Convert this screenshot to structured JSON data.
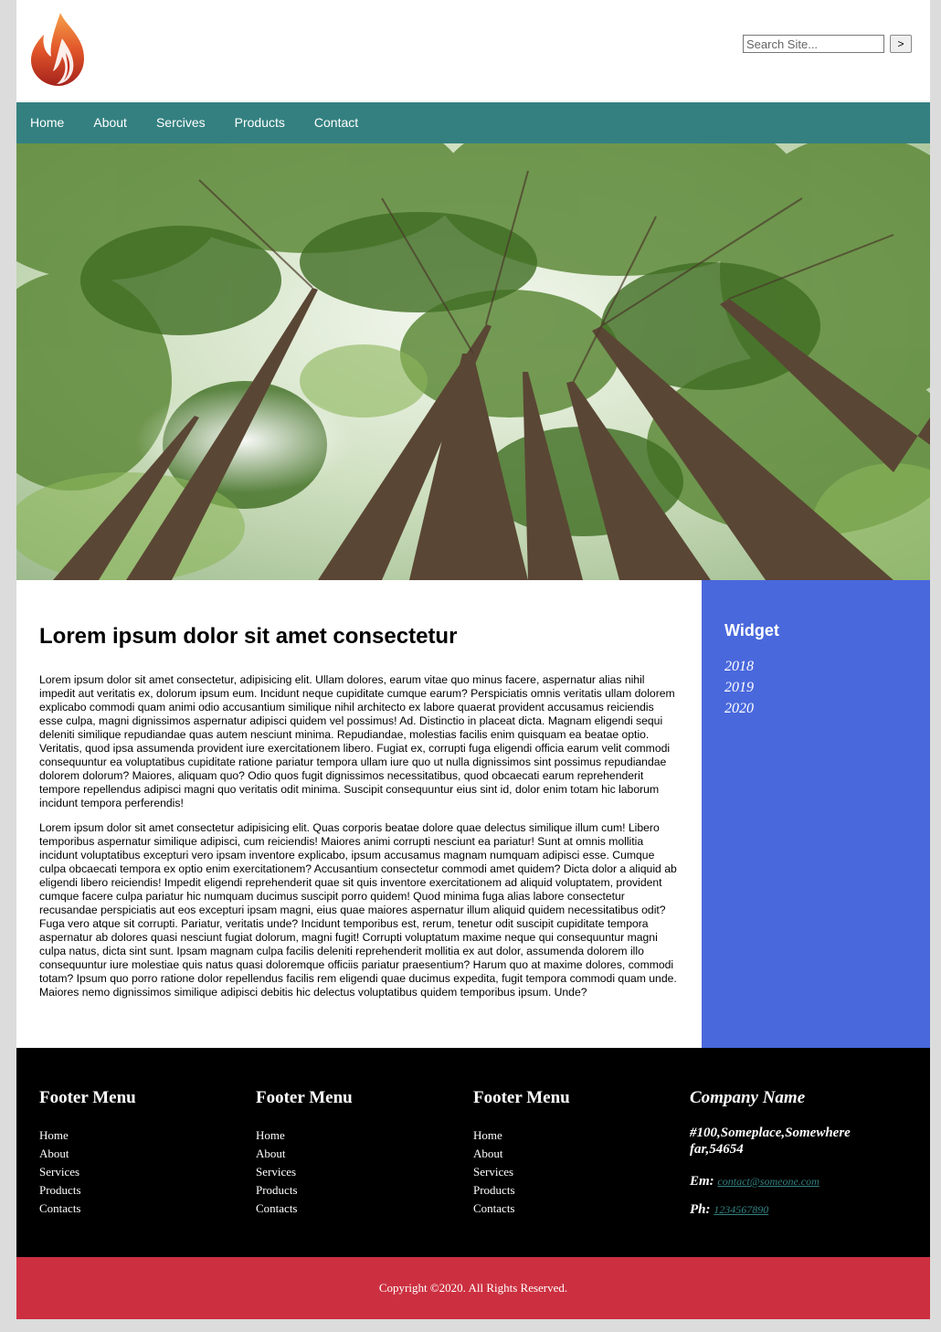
{
  "header": {
    "search_placeholder": "Search Site...",
    "search_button": ">"
  },
  "nav": {
    "items": [
      "Home",
      "About",
      "Sercives",
      "Products",
      "Contact"
    ]
  },
  "main": {
    "title": "Lorem ipsum dolor sit amet consectetur",
    "paragraph1": "Lorem ipsum dolor sit amet consectetur, adipisicing elit. Ullam dolores, earum vitae quo minus facere, aspernatur alias nihil impedit aut veritatis ex, dolorum ipsum eum. Incidunt neque cupiditate cumque earum? Perspiciatis omnis veritatis ullam dolorem explicabo commodi quam animi odio accusantium similique nihil architecto ex labore quaerat provident accusamus reiciendis esse culpa, magni dignissimos aspernatur adipisci quidem vel possimus! Ad. Distinctio in placeat dicta. Magnam eligendi sequi deleniti similique repudiandae quas autem nesciunt minima. Repudiandae, molestias facilis enim quisquam ea beatae optio. Veritatis, quod ipsa assumenda provident iure exercitationem libero. Fugiat ex, corrupti fuga eligendi officia earum velit commodi consequuntur ea voluptatibus cupiditate ratione pariatur tempora ullam iure quo ut nulla dignissimos sint possimus repudiandae dolorem dolorum? Maiores, aliquam quo? Odio quos fugit dignissimos necessitatibus, quod obcaecati earum reprehenderit tempore repellendus adipisci magni quo veritatis odit minima. Suscipit consequuntur eius sint id, dolor enim totam hic laborum incidunt tempora perferendis!",
    "paragraph2": "Lorem ipsum dolor sit amet consectetur adipisicing elit. Quas corporis beatae dolore quae delectus similique illum cum! Libero temporibus aspernatur similique adipisci, cum reiciendis! Maiores animi corrupti nesciunt ea pariatur! Sunt at omnis mollitia incidunt voluptatibus excepturi vero ipsam inventore explicabo, ipsum accusamus magnam numquam adipisci esse. Cumque culpa obcaecati tempora ex optio enim exercitationem? Accusantium consectetur commodi amet quidem? Dicta dolor a aliquid ab eligendi libero reiciendis! Impedit eligendi reprehenderit quae sit quis inventore exercitationem ad aliquid voluptatem, provident cumque facere culpa pariatur hic numquam ducimus suscipit porro quidem! Quod minima fuga alias labore consectetur recusandae perspiciatis aut eos excepturi ipsam magni, eius quae maiores aspernatur illum aliquid quidem necessitatibus odit? Fuga vero atque sit corrupti. Pariatur, veritatis unde? Incidunt temporibus est, rerum, tenetur odit suscipit cupiditate tempora aspernatur ab dolores quasi nesciunt fugiat dolorum, magni fugit! Corrupti voluptatum maxime neque qui consequuntur magni culpa natus, dicta sint sunt. Ipsam magnam culpa facilis deleniti reprehenderit mollitia ex aut dolor, assumenda dolorem illo consequuntur iure molestiae quis natus quasi doloremque officiis pariatur praesentium? Harum quo at maxime dolores, commodi totam? Ipsum quo porro ratione dolor repellendus facilis rem eligendi quae ducimus expedita, fugit tempora commodi quam unde. Maiores nemo dignissimos similique adipisci debitis hic delectus voluptatibus quidem temporibus ipsum. Unde?"
  },
  "sidebar": {
    "title": "Widget",
    "items": [
      "2018",
      "2019",
      "2020"
    ]
  },
  "footer": {
    "menus": [
      {
        "title": "Footer Menu",
        "items": [
          "Home",
          "About",
          "Services",
          "Products",
          "Contacts"
        ]
      },
      {
        "title": "Footer Menu",
        "items": [
          "Home",
          "About",
          "Services",
          "Products",
          "Contacts"
        ]
      },
      {
        "title": "Footer Menu",
        "items": [
          "Home",
          "About",
          "Services",
          "Products",
          "Contacts"
        ]
      }
    ],
    "company": {
      "title": "Company Name",
      "address": "#100,Someplace,Somewhere far,54654",
      "email_label": "Em:",
      "email": "contact@someone.com",
      "phone_label": "Ph:",
      "phone": "1234567890"
    },
    "copyright": "Copyright ©2020. All Rights Reserved."
  },
  "colors": {
    "nav": "#348080",
    "sidebar": "#4968dc",
    "footer": "#000000",
    "copyright_bar": "#cc3040",
    "link": "#348080"
  },
  "icons": {
    "logo": "flame-logo-icon"
  }
}
